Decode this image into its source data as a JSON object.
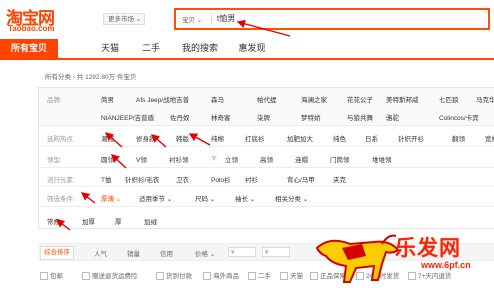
{
  "header": {
    "logo_cn": "淘宝网",
    "logo_en": "Taobao.com",
    "market_label": "更多市场 ⌄",
    "search_category": "宝贝 ⌄",
    "search_query": "t恤男"
  },
  "nav": {
    "tabs": [
      {
        "label": "所有宝贝",
        "active": true
      },
      {
        "label": "天猫"
      },
      {
        "label": "二手"
      },
      {
        "label": "我的搜索"
      },
      {
        "label": "惠发现"
      }
    ]
  },
  "breadcrumb": "所有分类 › 共 1292.80万 件宝贝",
  "filters": {
    "brand": {
      "label": "品牌:",
      "options": [
        "简男",
        "Afs Jeep/战地吉普",
        "森马",
        "帕代缇",
        "海澜之家",
        "花花公子",
        "美特斯邦威",
        "七匹狼",
        "马克华菲",
        "NIANJEEP/吉普盾",
        "佐丹奴",
        "林奇客",
        "柒牌",
        "梦特娇",
        "与狼共舞",
        "骆驼",
        "Colincos/卡宾"
      ]
    },
    "hot": {
      "label": "选购热点:",
      "options": [
        "潮流",
        "修身款",
        "韩版",
        "纯棉",
        "打底衫",
        "加肥加大",
        "纯色",
        "日系",
        "针织开衫",
        "翻领",
        "宽松"
      ]
    },
    "collar": {
      "label": "领型:",
      "options": [
        "圆领",
        "V领",
        "衬衫领",
        "立领",
        "高领",
        "连帽",
        "门筒领",
        "堆堆领"
      ]
    },
    "popular": {
      "label": "流行元素:",
      "options": [
        "T恤",
        "针织衫/毛衣",
        "卫衣",
        "Polo衫",
        "衬衫",
        "背心/马甲",
        "夹克"
      ]
    },
    "criteria": {
      "label": "筛选条件:",
      "dropdowns": [
        "厚薄 ⌄",
        "适用季节 ⌄",
        "尺码 ⌄",
        "袖长 ⌄",
        "相关分类 ⌄"
      ]
    },
    "thickness": {
      "options": [
        "常规",
        "加厚",
        "厚",
        "加绒"
      ]
    }
  },
  "sortbar": {
    "items": [
      "综合排序",
      "人气",
      "销量",
      "信用",
      "价格 ⌄"
    ],
    "price_placeholder": "¥"
  },
  "checks": [
    "包邮",
    "赠送退货运费险",
    "货到付款",
    "海外商品",
    "二手",
    "天猫",
    "正品保障",
    "24小时发货",
    "7+天内退货"
  ],
  "watermark": {
    "text": "乐发网",
    "url": "www.6pf.cn"
  },
  "colors": {
    "brand": "#ff4400",
    "annotation": "#e60000"
  }
}
